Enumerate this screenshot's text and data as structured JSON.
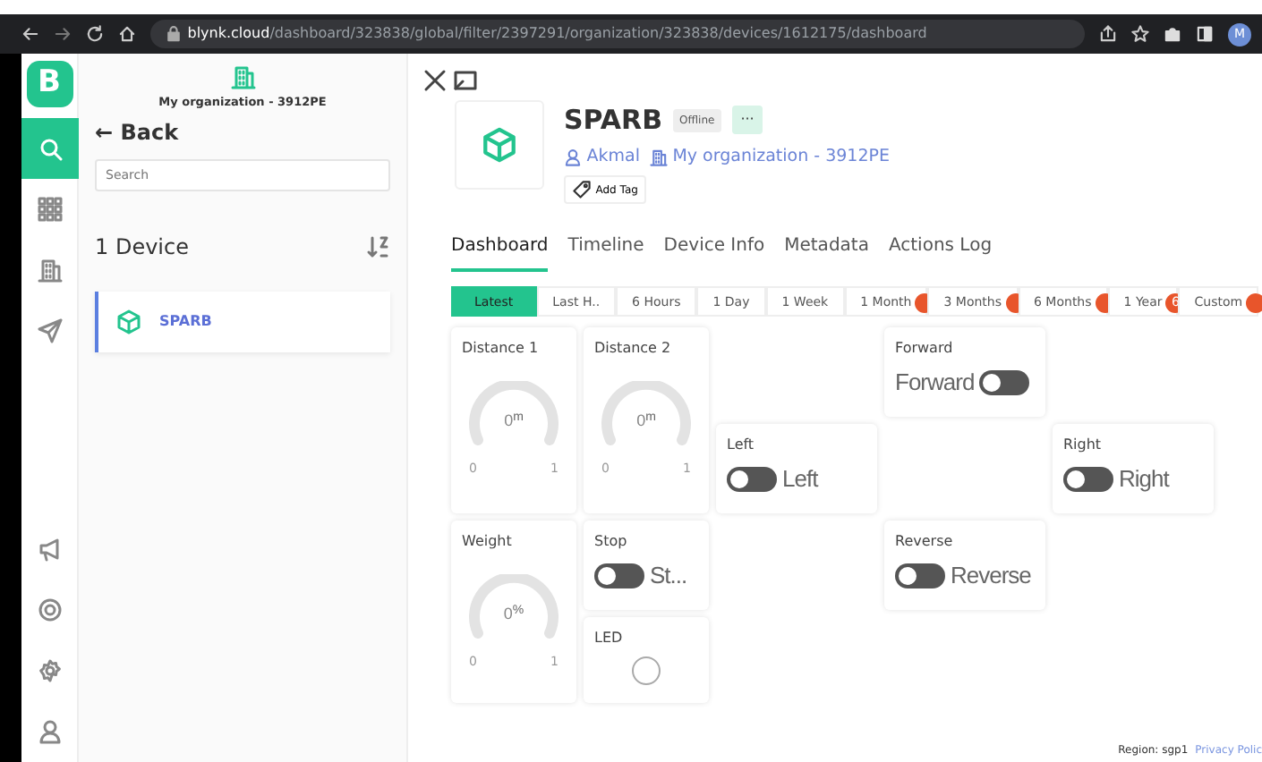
{
  "browser": {
    "url_host": "blynk.cloud",
    "url_path": "/dashboard/323838/global/filter/2397291/organization/323838/devices/1612175/dashboard",
    "avatar": "M"
  },
  "rail": {
    "logo": "B",
    "items": [
      {
        "kind": "search",
        "selected": true
      },
      {
        "kind": "grid",
        "selected": false
      },
      {
        "kind": "building",
        "selected": false
      },
      {
        "kind": "send",
        "selected": false
      }
    ],
    "bottom": [
      {
        "kind": "megaphone"
      },
      {
        "kind": "help"
      },
      {
        "kind": "settings"
      },
      {
        "kind": "user"
      }
    ]
  },
  "sidebar": {
    "org": "My organization - 3912PE",
    "back": "← Back",
    "search": {
      "placeholder": "Search"
    },
    "count": "1 Device",
    "devices": [
      {
        "name": "SPARB",
        "selected": true
      }
    ]
  },
  "device": {
    "name": "SPARB",
    "status": "Offline",
    "owner": "Akmal",
    "org": "My organization - 3912PE",
    "add_tag": "Add Tag",
    "more": "···"
  },
  "tabs": [
    {
      "label": "Dashboard",
      "selected": true
    },
    {
      "label": "Timeline",
      "selected": false
    },
    {
      "label": "Device Info",
      "selected": false
    },
    {
      "label": "Metadata",
      "selected": false
    },
    {
      "label": "Actions Log",
      "selected": false
    }
  ],
  "ranges": [
    {
      "label": "Latest",
      "selected": true,
      "alert": false
    },
    {
      "label": "Last H..",
      "selected": false,
      "alert": false
    },
    {
      "label": "6 Hours",
      "selected": false,
      "alert": false
    },
    {
      "label": "1 Day",
      "selected": false,
      "alert": false
    },
    {
      "label": "1 Week",
      "selected": false,
      "alert": false
    },
    {
      "label": "1 Month",
      "selected": false,
      "alert": true
    },
    {
      "label": "3 Months",
      "selected": false,
      "alert": true
    },
    {
      "label": "6 Months",
      "selected": false,
      "alert": true
    },
    {
      "label": "1 Year",
      "selected": false,
      "alert": true,
      "count": "6"
    },
    {
      "label": "Custom",
      "selected": false,
      "alert": true
    }
  ],
  "widgets": [
    {
      "kind": "gauge",
      "title": "Distance 1",
      "value": "0",
      "unit": "m",
      "min": "0",
      "max": "1"
    },
    {
      "kind": "gauge",
      "title": "Distance 2",
      "value": "0",
      "unit": "m",
      "min": "0",
      "max": "1"
    },
    {
      "kind": "switch",
      "title": "Left",
      "label": "Left",
      "on": false,
      "label_after": true
    },
    {
      "kind": "switch",
      "title": "Forward",
      "label": "Forward",
      "on": false,
      "label_after": false
    },
    {
      "kind": "switch",
      "title": "Right",
      "label": "Right",
      "on": false,
      "label_after": true
    },
    {
      "kind": "gauge",
      "title": "Weight",
      "value": "0",
      "unit": "%",
      "min": "0",
      "max": "1"
    },
    {
      "kind": "switch",
      "title": "Stop",
      "label": "St...",
      "on": false,
      "label_after": true
    },
    {
      "kind": "led",
      "title": "LED",
      "on": false
    },
    {
      "kind": "switch",
      "title": "Reverse",
      "label": "Reverse",
      "on": false,
      "label_after": true
    }
  ],
  "footer": {
    "region": "Region: sgp1",
    "privacy": "Privacy Polic"
  }
}
